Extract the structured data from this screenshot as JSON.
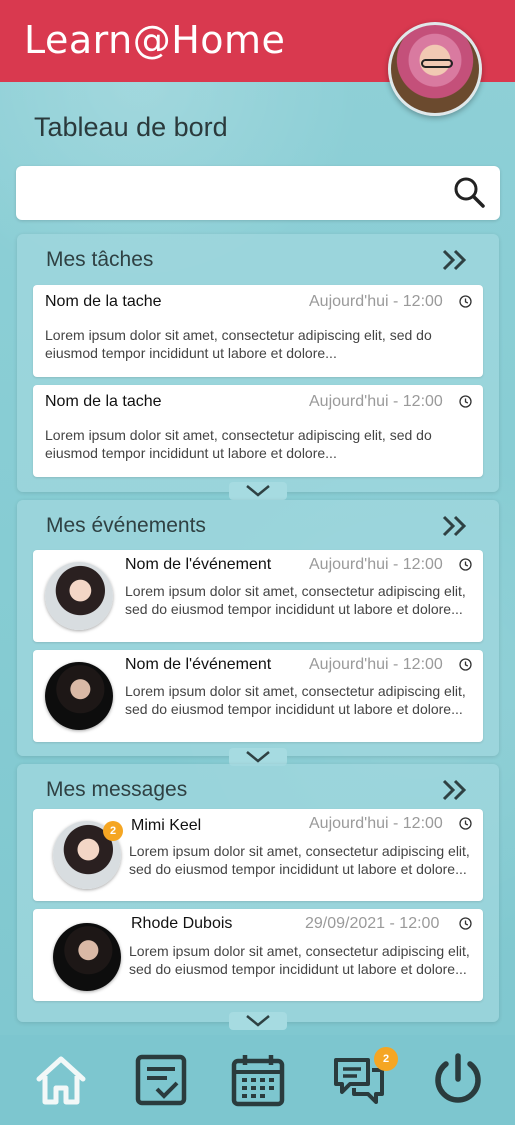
{
  "app": {
    "title": "Learn@Home"
  },
  "page": {
    "title": "Tableau de bord"
  },
  "search": {
    "value": "",
    "placeholder": ""
  },
  "sections": {
    "tasks": {
      "title": "Mes tâches",
      "items": [
        {
          "title": "Nom de la tache",
          "time": "Aujourd'hui - 12:00",
          "body": "Lorem ipsum dolor sit amet, consectetur adipiscing elit, sed do eiusmod tempor incididunt ut labore et dolore..."
        },
        {
          "title": "Nom de la tache",
          "time": "Aujourd'hui - 12:00",
          "body": "Lorem ipsum dolor sit amet, consectetur adipiscing elit, sed do eiusmod tempor incididunt ut labore et dolore..."
        }
      ]
    },
    "events": {
      "title": "Mes événements",
      "items": [
        {
          "title": "Nom de l'événement",
          "time": "Aujourd'hui - 12:00",
          "body": "Lorem ipsum dolor sit amet, consectetur adipiscing elit, sed do eiusmod tempor incididunt ut labore et dolore..."
        },
        {
          "title": "Nom de l'événement",
          "time": "Aujourd'hui - 12:00",
          "body": "Lorem ipsum dolor sit amet, consectetur adipiscing elit, sed do eiusmod tempor incididunt ut labore et dolore..."
        }
      ]
    },
    "messages": {
      "title": "Mes messages",
      "items": [
        {
          "sender": "Mimi Keel",
          "time": "Aujourd'hui - 12:00",
          "badge": "2",
          "body": "Lorem ipsum dolor sit amet, consectetur adipiscing elit, sed do eiusmod tempor incididunt ut labore et dolore..."
        },
        {
          "sender": "Rhode Dubois",
          "time": "29/09/2021 - 12:00",
          "body": "Lorem ipsum dolor sit amet, consectetur adipiscing elit, sed do eiusmod tempor incididunt ut labore et dolore..."
        }
      ]
    }
  },
  "nav": {
    "items": [
      {
        "icon": "home-icon"
      },
      {
        "icon": "tasks-icon"
      },
      {
        "icon": "calendar-icon"
      },
      {
        "icon": "chat-icon",
        "badge": "2"
      },
      {
        "icon": "power-icon"
      }
    ]
  },
  "colors": {
    "header": "#d9394f",
    "background": "#8ecfd6",
    "badge": "#f5a623",
    "navbar": "#7dc6cf"
  }
}
